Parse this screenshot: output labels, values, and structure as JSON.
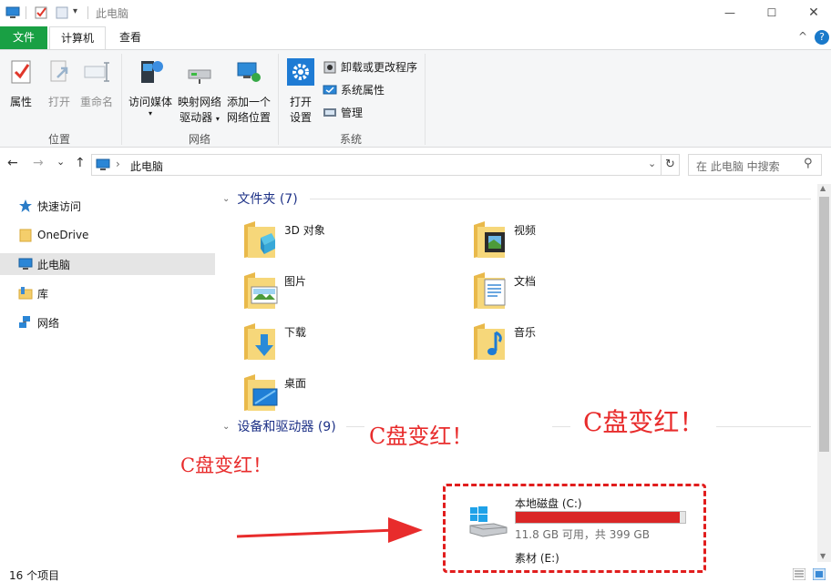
{
  "window": {
    "title": "此电脑",
    "minimize_label": "—",
    "maximize_label": "☐",
    "help_label": "?",
    "collapse_label": "^"
  },
  "ribbon": {
    "tabs": [
      {
        "label": "文件",
        "accent": "#19a044"
      },
      {
        "label": "计算机"
      },
      {
        "label": "查看"
      }
    ],
    "groups": [
      {
        "label": "位置",
        "buttons": [
          {
            "label": "属性",
            "icon": "properties-icon",
            "enabled": true
          },
          {
            "label": "打开",
            "icon": "open-icon",
            "enabled": false
          },
          {
            "label": "重命名",
            "icon": "rename-icon",
            "enabled": false
          }
        ]
      },
      {
        "label": "网络",
        "buttons": [
          {
            "label": "访问媒体",
            "icon": "access-media-icon"
          },
          {
            "label_line1": "映射网络",
            "label_line2": "驱动器",
            "icon": "map-drive-icon"
          },
          {
            "label_line1": "添加一个",
            "label_line2": "网络位置",
            "icon": "add-network-location-icon"
          }
        ]
      },
      {
        "label": "系统",
        "buttons": [
          {
            "label_line1": "打开",
            "label_line2": "设置",
            "icon": "settings-gear-icon"
          }
        ],
        "small_items": [
          {
            "label": "卸载或更改程序",
            "icon": "uninstall-icon"
          },
          {
            "label": "系统属性",
            "icon": "system-properties-icon"
          },
          {
            "label": "管理",
            "icon": "manage-icon"
          }
        ]
      }
    ]
  },
  "nav": {
    "back": "←",
    "forward": "→",
    "recent": "⌄",
    "up": "↑",
    "breadcrumb": "此电脑",
    "breadcrumb_sep": "›",
    "dropdown": "⌄",
    "refresh": "↻",
    "search_placeholder": "在 此电脑 中搜索",
    "search_icon": "⚲"
  },
  "sidebar": {
    "items": [
      {
        "label": "快速访问",
        "icon": "quick-access-star-icon"
      },
      {
        "label": "OneDrive",
        "icon": "onedrive-folder-icon"
      },
      {
        "label": "此电脑",
        "icon": "this-pc-icon",
        "selected": true
      },
      {
        "label": "库",
        "icon": "libraries-icon"
      },
      {
        "label": "网络",
        "icon": "network-icon"
      }
    ]
  },
  "content": {
    "folders_header": "文件夹 (7)",
    "folders": [
      {
        "label": "3D 对象",
        "icon": "3d-objects-folder-icon"
      },
      {
        "label": "视频",
        "icon": "videos-folder-icon"
      },
      {
        "label": "图片",
        "icon": "pictures-folder-icon"
      },
      {
        "label": "文档",
        "icon": "documents-folder-icon"
      },
      {
        "label": "下载",
        "icon": "downloads-folder-icon"
      },
      {
        "label": "音乐",
        "icon": "music-folder-icon"
      },
      {
        "label": "桌面",
        "icon": "desktop-folder-icon"
      }
    ],
    "devices_header": "设备和驱动器 (9)",
    "drives": [
      {
        "label": "本地磁盘 (C:)",
        "free_text": "11.8 GB 可用，共 399 GB",
        "used_fraction": 0.97,
        "bar_color": "#da2626",
        "icon": "windows-drive-icon"
      },
      {
        "label": "素材 (E:)"
      }
    ]
  },
  "annotations": {
    "note1": "C盘变红！",
    "note2": "C盘变红！",
    "note3": "C盘变红！",
    "color": "#e82c2c"
  },
  "status": {
    "items_count": "16 个项目"
  }
}
